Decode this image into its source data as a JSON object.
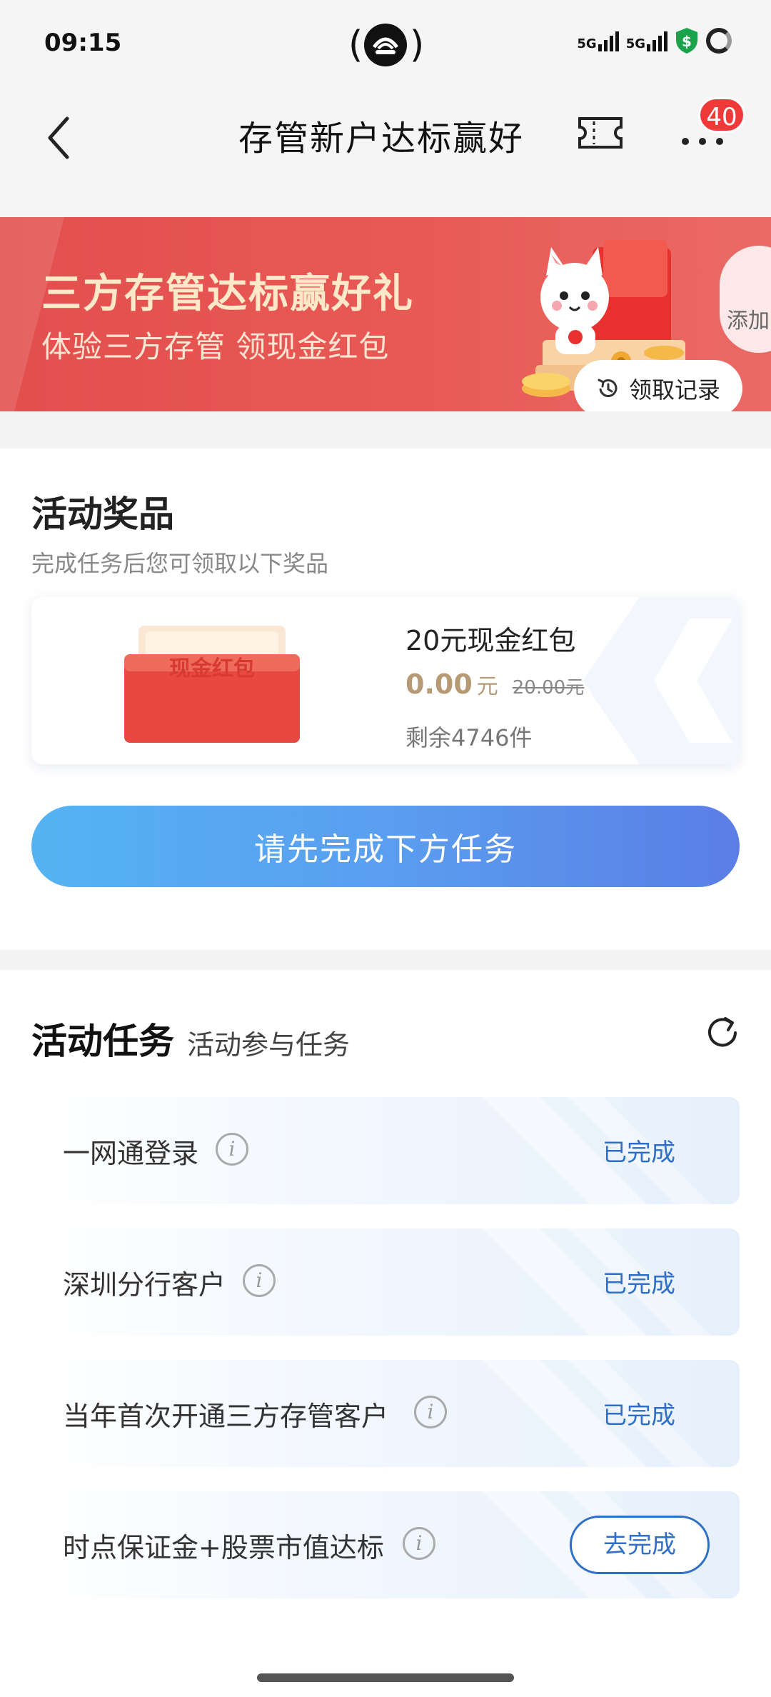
{
  "status_bar": {
    "time": "09:15",
    "network_1": "5G",
    "network_2": "5G"
  },
  "nav": {
    "title": "存管新户达标赢好",
    "badge_count": "40"
  },
  "banner": {
    "title": "三方存管达标赢好礼",
    "subtitle": "体验三方存管 领现金红包",
    "add_label": "添加",
    "record_button": "领取记录"
  },
  "prize_section": {
    "title": "活动奖品",
    "subtitle": "完成任务后您可领取以下奖品",
    "prize": {
      "envelope_text": "现金红包",
      "name": "20元现金红包",
      "price": "0.00",
      "price_unit": "元",
      "original_price": "20.00元",
      "stock": "剩余4746件"
    },
    "cta": "请先完成下方任务"
  },
  "task_section": {
    "title": "活动任务",
    "subtitle": "活动参与任务",
    "tasks": [
      {
        "label": "一网通登录",
        "status": "已完成"
      },
      {
        "label": "深圳分行客户",
        "status": "已完成"
      },
      {
        "label": "当年首次开通三方存管客户",
        "status": "已完成"
      },
      {
        "label": "时点保证金+股票市值达标",
        "status": "去完成"
      }
    ],
    "info_glyph": "i"
  },
  "colors": {
    "banner_red": "#e24f4e",
    "cta_blue": "#5a9ef0",
    "link_blue": "#2f6fc7",
    "price_gold": "#b59a73",
    "badge_red": "#f03a3a"
  }
}
